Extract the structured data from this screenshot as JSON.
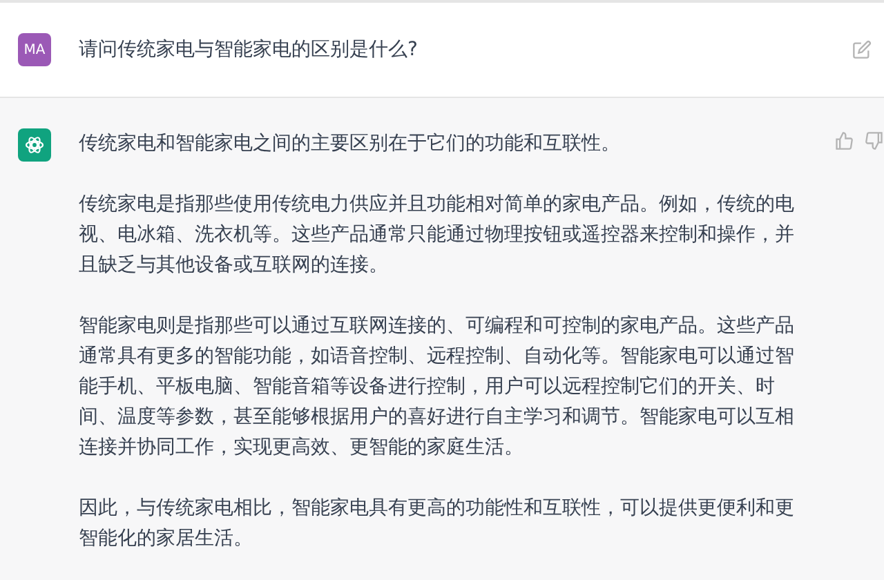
{
  "messages": [
    {
      "kind": "user",
      "avatar": "MA",
      "paragraphs": [
        "请问传统家电与智能家电的区别是什么?"
      ]
    },
    {
      "kind": "assistant",
      "paragraphs": [
        "传统家电和智能家电之间的主要区别在于它们的功能和互联性。",
        "传统家电是指那些使用传统电力供应并且功能相对简单的家电产品。例如，传统的电视、电冰箱、洗衣机等。这些产品通常只能通过物理按钮或遥控器来控制和操作，并且缺乏与其他设备或互联网的连接。",
        "智能家电则是指那些可以通过互联网连接的、可编程和可控制的家电产品。这些产品通常具有更多的智能功能，如语音控制、远程控制、自动化等。智能家电可以通过智能手机、平板电脑、智能音箱等设备进行控制，用户可以远程控制它们的开关、时间、温度等参数，甚至能够根据用户的喜好进行自主学习和调节。智能家电可以互相连接并协同工作，实现更高效、更智能的家庭生活。",
        "因此，与传统家电相比，智能家电具有更高的功能性和互联性，可以提供更便利和更智能化的家居生活。"
      ]
    }
  ]
}
